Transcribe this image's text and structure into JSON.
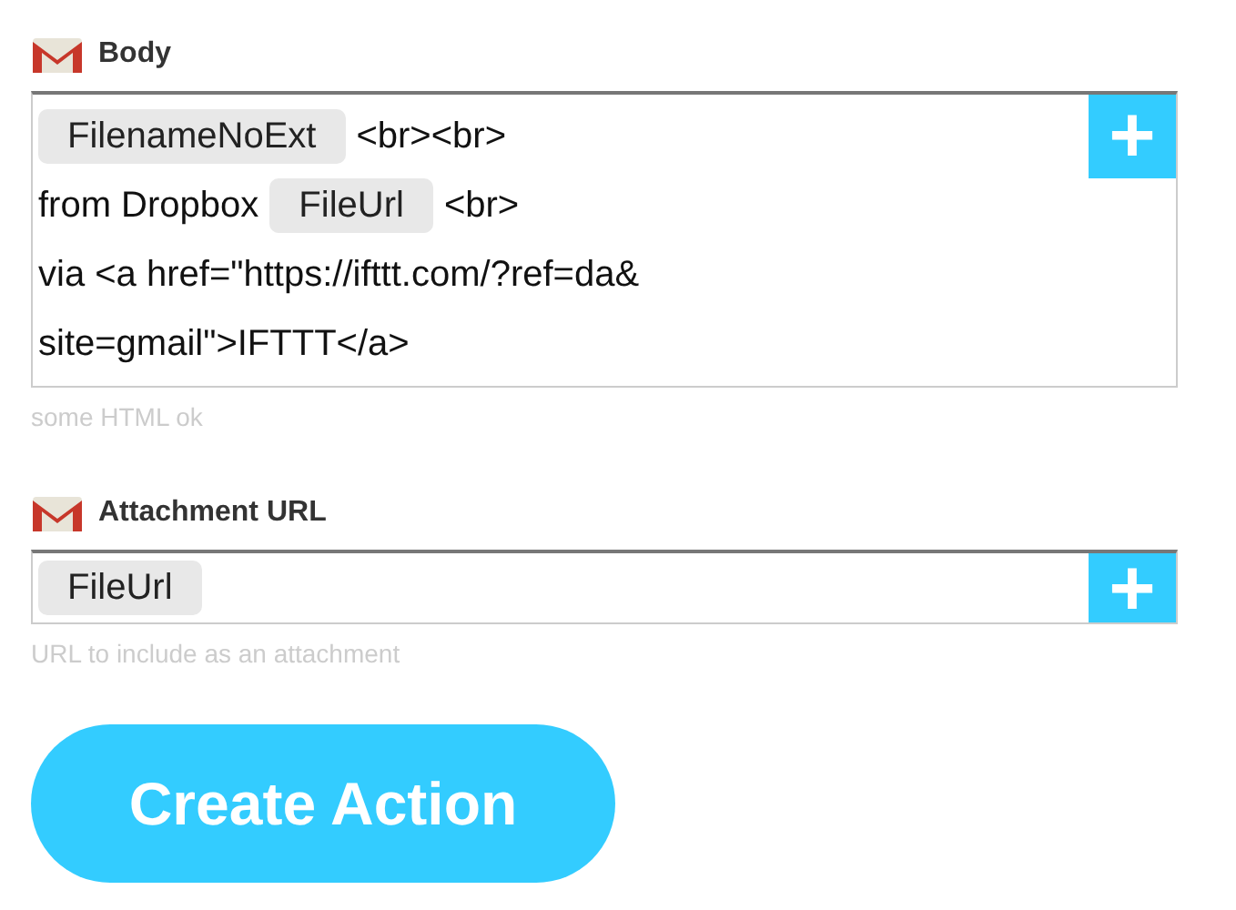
{
  "fields": [
    {
      "label": "Body",
      "lines": [
        [
          {
            "kind": "tag",
            "text": "FilenameNoExt"
          },
          {
            "kind": "text",
            "text": "<br><br>"
          }
        ],
        [
          {
            "kind": "text",
            "text": "from Dropbox"
          },
          {
            "kind": "tag",
            "text": "FileUrl"
          },
          {
            "kind": "text",
            "text": "<br>"
          }
        ],
        [
          {
            "kind": "text",
            "text": "via <a href=\"https://ifttt.com/?ref=da&"
          }
        ],
        [
          {
            "kind": "text",
            "text": "site=gmail\">IFTTT</a>"
          }
        ]
      ],
      "add_button": "+",
      "hint": "some HTML ok"
    },
    {
      "label": "Attachment URL",
      "lines": [
        [
          {
            "kind": "tag",
            "text": "FileUrl"
          }
        ]
      ],
      "add_button": "+",
      "hint": "URL to include as an attachment"
    }
  ],
  "submit": "Create Action"
}
